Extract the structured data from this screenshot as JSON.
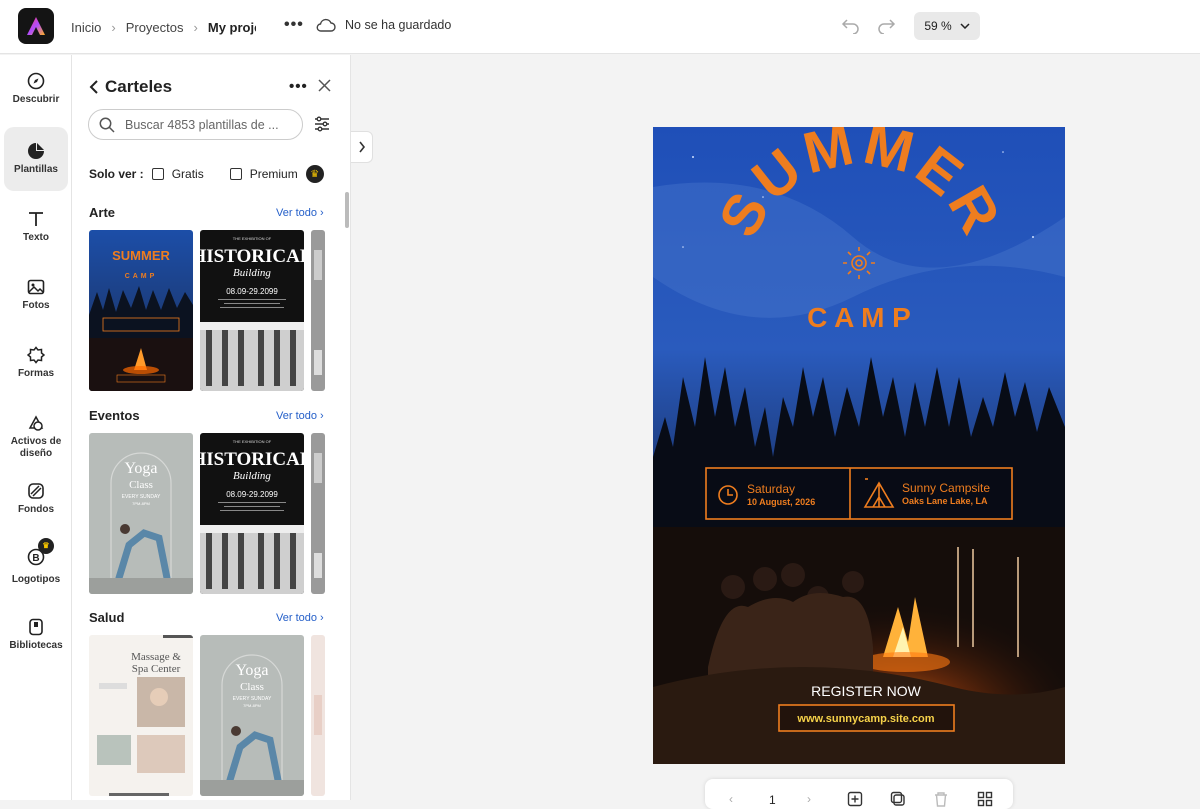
{
  "topbar": {
    "breadcrumbs": [
      "Inicio",
      "Proyectos",
      "My proje"
    ],
    "save_status": "No se ha guardado",
    "zoom": "59 %"
  },
  "rail": {
    "items": [
      {
        "label": "Descubrir",
        "icon": "compass-icon"
      },
      {
        "label": "Plantillas",
        "icon": "templates-icon"
      },
      {
        "label": "Texto",
        "icon": "text-icon"
      },
      {
        "label": "Fotos",
        "icon": "photo-icon"
      },
      {
        "label": "Formas",
        "icon": "shapes-icon"
      },
      {
        "label": "Activos de diseño",
        "icon": "design-assets-icon"
      },
      {
        "label": "Fondos",
        "icon": "backgrounds-icon"
      },
      {
        "label": "Logotipos",
        "icon": "logo-icon"
      },
      {
        "label": "Bibliotecas",
        "icon": "libraries-icon"
      }
    ]
  },
  "panel": {
    "title": "Carteles",
    "search_placeholder": "Buscar 4853 plantillas de ...",
    "filter_label": "Solo ver :",
    "filter_free": "Gratis",
    "filter_premium": "Premium",
    "sections": [
      {
        "name": "Arte",
        "see_all": "Ver todo"
      },
      {
        "name": "Eventos",
        "see_all": "Ver todo"
      },
      {
        "name": "Salud",
        "see_all": "Ver todo"
      }
    ]
  },
  "thumbnails": {
    "summer": "SUMMER",
    "camp": "CAMP",
    "historical_top": "THE EXHIBITION OF",
    "historical_title": "HISTORICAL",
    "historical_sub": "Building",
    "historical_date": "08.09-29.2099",
    "yoga_title": "Yoga",
    "yoga_sub": "Class",
    "yoga_line": "EVERY SUNDAY",
    "yoga_time": "7PM-8PM",
    "massage_title": "Massage &",
    "massage_sub": "Spa Center"
  },
  "poster": {
    "title": "SUMMER",
    "subtitle": "C A M P",
    "day": "Saturday",
    "date": "10 August, 2026",
    "place": "Sunny Campsite",
    "address": "Oaks Lane Lake, LA",
    "cta": "REGISTER NOW",
    "website": "www.sunnycamp.site.com"
  },
  "pager": {
    "page": "1"
  },
  "colors": {
    "accent_orange": "#ee7d1f",
    "link_blue": "#2660c9",
    "rail_active": "#ececec"
  }
}
